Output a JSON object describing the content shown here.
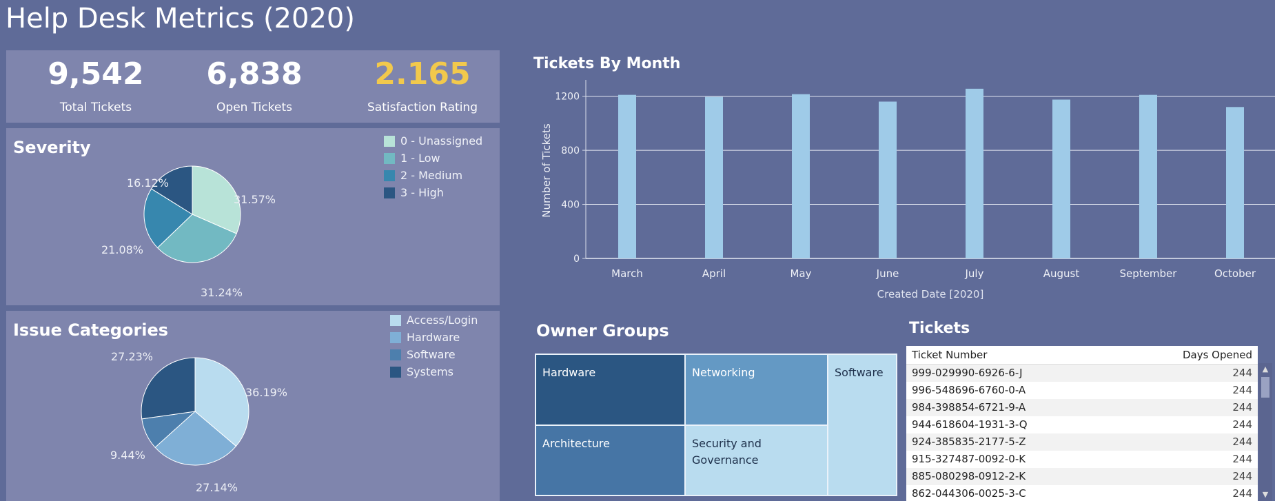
{
  "dashboard": {
    "title": "Help Desk Metrics (2020)"
  },
  "kpis": [
    {
      "value": "9,542",
      "label": "Total Tickets",
      "color": "#ffffff"
    },
    {
      "value": "6,838",
      "label": "Open Tickets",
      "color": "#ffffff"
    },
    {
      "value": "2.165",
      "label": "Satisfaction Rating",
      "color": "#f2c94c"
    }
  ],
  "severity": {
    "title": "Severity",
    "legend": [
      {
        "label": "0 - Unassigned",
        "color": "#b8e3d8"
      },
      {
        "label": "1 - Low",
        "color": "#72b9c2"
      },
      {
        "label": "2 - Medium",
        "color": "#3787ae"
      },
      {
        "label": "3 - High",
        "color": "#2b5682"
      }
    ],
    "labels": [
      "31.57%",
      "31.24%",
      "21.08%",
      "16.12%"
    ]
  },
  "issues": {
    "title": "Issue Categories",
    "legend": [
      {
        "label": "Access/Login",
        "color": "#b9dcef"
      },
      {
        "label": "Hardware",
        "color": "#7fafd6"
      },
      {
        "label": "Software",
        "color": "#4d7fad"
      },
      {
        "label": "Systems",
        "color": "#2b5682"
      }
    ],
    "labels": [
      "36.19%",
      "27.14%",
      "9.44%",
      "27.23%"
    ]
  },
  "chart_data": [
    {
      "type": "bar",
      "title": "Tickets By Month",
      "xlabel": "Created Date [2020]",
      "ylabel": "Number of Tickets",
      "categories": [
        "March",
        "April",
        "May",
        "June",
        "July",
        "August",
        "September",
        "October"
      ],
      "values": [
        1210,
        1195,
        1215,
        1160,
        1255,
        1175,
        1210,
        1120
      ],
      "ylim": [
        0,
        1300
      ],
      "yticks": [
        0,
        400,
        800,
        1200
      ],
      "grid": true,
      "color": "#9fcbe8"
    },
    {
      "type": "pie",
      "title": "Severity",
      "categories": [
        "0 - Unassigned",
        "1 - Low",
        "2 - Medium",
        "3 - High"
      ],
      "values": [
        31.57,
        31.24,
        21.08,
        16.12
      ]
    },
    {
      "type": "pie",
      "title": "Issue Categories",
      "categories": [
        "Access/Login",
        "Hardware",
        "Software",
        "Systems"
      ],
      "values": [
        36.19,
        27.14,
        9.44,
        27.23
      ]
    }
  ],
  "owner_groups": {
    "title": "Owner Groups",
    "tiles": [
      {
        "label": "Hardware",
        "color": "#2b5682",
        "text_color": "#ffffff"
      },
      {
        "label": "Networking",
        "color": "#6499c4",
        "text_color": "#ffffff"
      },
      {
        "label": "Software",
        "color": "#b9dcef",
        "text_color": "#1d2f4a"
      },
      {
        "label": "Architecture",
        "color": "#4675a5",
        "text_color": "#ffffff"
      },
      {
        "label": "Security and Governance",
        "color": "#b9dcef",
        "text_color": "#1d2f4a"
      }
    ]
  },
  "tickets": {
    "title": "Tickets",
    "columns": [
      "Ticket Number",
      "Days Opened"
    ],
    "rows": [
      [
        "999-029990-6926-6-J",
        "244"
      ],
      [
        "996-548696-6760-0-A",
        "244"
      ],
      [
        "984-398854-6721-9-A",
        "244"
      ],
      [
        "944-618604-1931-3-Q",
        "244"
      ],
      [
        "924-385835-2177-5-Z",
        "244"
      ],
      [
        "915-327487-0092-0-K",
        "244"
      ],
      [
        "885-080298-0912-2-K",
        "244"
      ],
      [
        "862-044306-0025-3-C",
        "244"
      ]
    ]
  }
}
